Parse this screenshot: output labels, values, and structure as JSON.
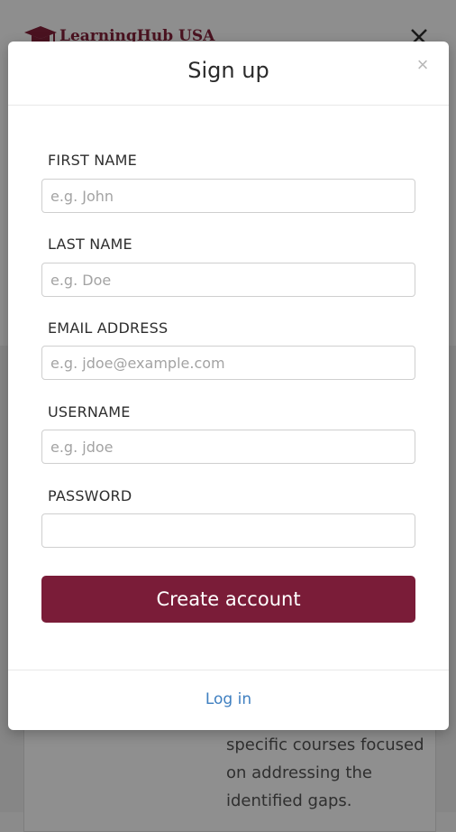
{
  "background": {
    "brand": {
      "name": "LearningHub USA",
      "color": "#4a1220"
    },
    "body_text": [
      "specific courses focused",
      "on addressing the",
      "identified gaps."
    ]
  },
  "modal": {
    "title": "Sign up",
    "close_label": "×",
    "fields": [
      {
        "label": "FIRST NAME",
        "placeholder": "e.g. John",
        "value": ""
      },
      {
        "label": "LAST NAME",
        "placeholder": "e.g. Doe",
        "value": ""
      },
      {
        "label": "EMAIL ADDRESS",
        "placeholder": "e.g. jdoe@example.com",
        "value": ""
      },
      {
        "label": "USERNAME",
        "placeholder": "e.g. jdoe",
        "value": ""
      },
      {
        "label": "PASSWORD",
        "placeholder": "",
        "value": ""
      }
    ],
    "submit_label": "Create account",
    "login_label": "Log in"
  },
  "colors": {
    "accent": "#7a1c38",
    "link": "#3f7fc0",
    "overlay": "#8b8b8b"
  },
  "icons": {
    "logo": "graduation-cap-icon",
    "menu_close": "close-icon"
  }
}
